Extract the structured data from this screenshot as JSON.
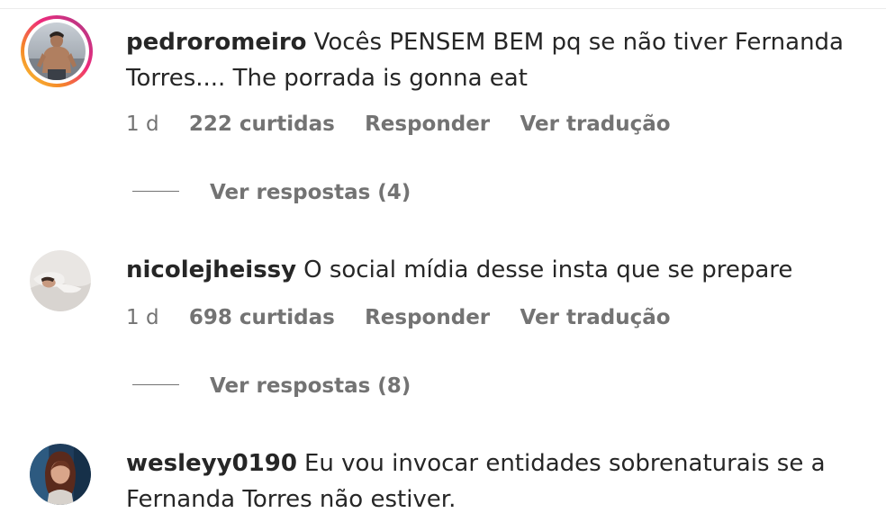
{
  "comments": [
    {
      "username": "pedroromeiro",
      "text": "Vocês PENSEM BEM pq se não tiver Fernanda Torres.... The porrada is gonna eat",
      "time": "1 d",
      "likes": "222 curtidas",
      "reply_label": "Responder",
      "translate_label": "Ver tradução",
      "replies_label": "Ver respostas (4)",
      "avatar_icon": "profile-photo-shirtless-man"
    },
    {
      "username": "nicolejheissy",
      "text": "O social mídia desse insta que se prepare",
      "time": "1 d",
      "likes": "698 curtidas",
      "reply_label": "Responder",
      "translate_label": "Ver tradução",
      "replies_label": "Ver respostas (8)",
      "avatar_icon": "profile-photo-woman-lying"
    },
    {
      "username": "wesleyy0190",
      "text": "Eu vou invocar entidades sobrenaturais se a Fernanda Torres não estiver.",
      "avatar_icon": "profile-photo-woman-portrait"
    }
  ],
  "colors": {
    "text": "#262626",
    "secondary": "#737373",
    "story_ring_start": "#f9ce34",
    "story_ring_end": "#8a3ab9"
  }
}
